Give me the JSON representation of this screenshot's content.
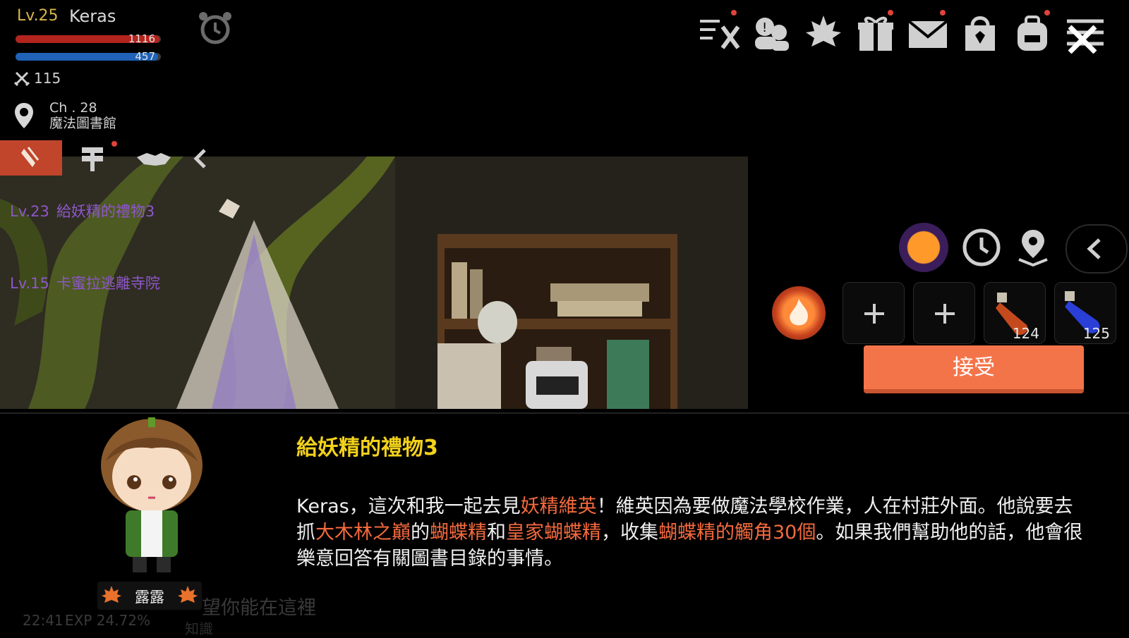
{
  "player": {
    "level": "Lv.25",
    "name": "Keras",
    "hp_value": "1116",
    "hp_fraction": 0.99,
    "mp_value": "457",
    "mp_fraction": 0.98,
    "attack": "115",
    "channel": "Ch . 28",
    "map_name": "魔法圖書館"
  },
  "top_menu": {
    "icons": [
      "quest-tools-icon",
      "social-icon",
      "maple-guild-icon",
      "gift-icon",
      "mail-icon",
      "cash-shop-icon",
      "inventory-bag-icon",
      "main-menu-icon"
    ],
    "close_icon": "close-icon"
  },
  "quest_list": [
    {
      "level": "Lv.23",
      "name": "給妖精的禮物3"
    },
    {
      "level": "Lv.15",
      "name": "卡蜜拉逃離寺院"
    }
  ],
  "quick_slots": {
    "potion_red_count": "124",
    "potion_blue_count": "125"
  },
  "accept_label": "接受",
  "dialogue": {
    "title": "給妖精的禮物3",
    "npc_name": "露露",
    "segments": [
      {
        "text": "Keras，這次和我一起去見",
        "highlight": false
      },
      {
        "text": "妖精維英",
        "highlight": true
      },
      {
        "text": "！維英因為要做魔法學校作業，人在村莊外面。他說要去抓",
        "highlight": false
      },
      {
        "text": "大木林之巔",
        "highlight": true
      },
      {
        "text": "的",
        "highlight": false
      },
      {
        "text": "蝴蝶精",
        "highlight": true
      },
      {
        "text": "和",
        "highlight": false
      },
      {
        "text": "皇家蝴蝶精",
        "highlight": true
      },
      {
        "text": "，收集",
        "highlight": false
      },
      {
        "text": "蝴蝶精的觸角30個",
        "highlight": true
      },
      {
        "text": "。如果我們幫助他的話，他會很樂意回答有關圖書目錄的事情。",
        "highlight": false
      }
    ]
  },
  "background_chat": {
    "time": "22:41",
    "exp": "EXP 24.72%",
    "line1": "望你能在這裡",
    "line2": "知識"
  },
  "colors": {
    "accept": "#f4744a",
    "highlight": "#f46a3e",
    "title": "#f2d21b",
    "quest_text": "#8e57c9",
    "hp": "#b3241e",
    "mp": "#1f62b8"
  }
}
